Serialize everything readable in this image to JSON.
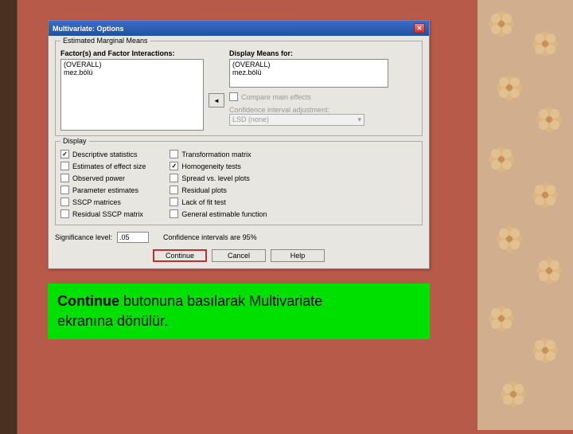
{
  "dialog": {
    "title": "Multivariate: Options",
    "group_emm": "Estimated Marginal Means",
    "factors_label": "Factor(s) and Factor Interactions:",
    "display_means_label": "Display Means for:",
    "left_items": [
      "(OVERALL)",
      "mez.bölü"
    ],
    "right_items": [
      "(OVERALL)",
      "mez.bölü"
    ],
    "compare_main": "Compare main effects",
    "ci_adjust_label": "Confidence interval adjustment:",
    "ci_adjust_value": "LSD (none)",
    "group_display": "Display",
    "left_checks": [
      {
        "label": "Descriptive statistics",
        "checked": true
      },
      {
        "label": "Estimates of effect size",
        "checked": false
      },
      {
        "label": "Observed power",
        "checked": false
      },
      {
        "label": "Parameter estimates",
        "checked": false
      },
      {
        "label": "SSCP matrices",
        "checked": false
      },
      {
        "label": "Residual SSCP matrix",
        "checked": false
      }
    ],
    "right_checks": [
      {
        "label": "Transformation matrix",
        "checked": false
      },
      {
        "label": "Homogeneity tests",
        "checked": true
      },
      {
        "label": "Spread vs. level plots",
        "checked": false
      },
      {
        "label": "Residual plots",
        "checked": false
      },
      {
        "label": "Lack of fit test",
        "checked": false
      },
      {
        "label": "General estimable function",
        "checked": false
      }
    ],
    "sig_label": "Significance level:",
    "sig_value": ".05",
    "ci_text": "Confidence intervals are 95%",
    "btn_continue": "Continue",
    "btn_cancel": "Cancel",
    "btn_help": "Help"
  },
  "caption": {
    "bold": "Continue",
    "rest1": " butonuna basılarak Multivariate",
    "rest2": "ekranına dönülür."
  }
}
